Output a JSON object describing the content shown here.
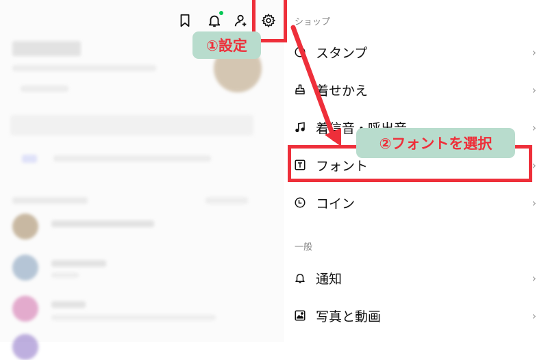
{
  "top_icons": [
    {
      "name": "bookmark-icon"
    },
    {
      "name": "bell-icon",
      "badge_color": "#06c755"
    },
    {
      "name": "add-friend-icon"
    },
    {
      "name": "gear-icon"
    }
  ],
  "settings": {
    "sections": [
      {
        "header": "ショップ",
        "items": [
          {
            "label": "スタンプ",
            "icon": "sticker-icon"
          },
          {
            "label": "着せかえ",
            "icon": "theme-icon"
          },
          {
            "label": "着信音・呼出音",
            "icon": "music-note-icon"
          },
          {
            "label": "フォント",
            "icon": "font-icon"
          },
          {
            "label": "コイン",
            "icon": "coin-icon"
          }
        ]
      },
      {
        "header": "一般",
        "items": [
          {
            "label": "通知",
            "icon": "bell-icon"
          },
          {
            "label": "写真と動画",
            "icon": "photo-icon"
          }
        ]
      }
    ],
    "chevron": "›"
  },
  "annotations": {
    "step1": "①設定",
    "step2": "②フォントを選択",
    "highlight_color": "#ee2f3a",
    "callout_bg": "#b8dccd"
  }
}
